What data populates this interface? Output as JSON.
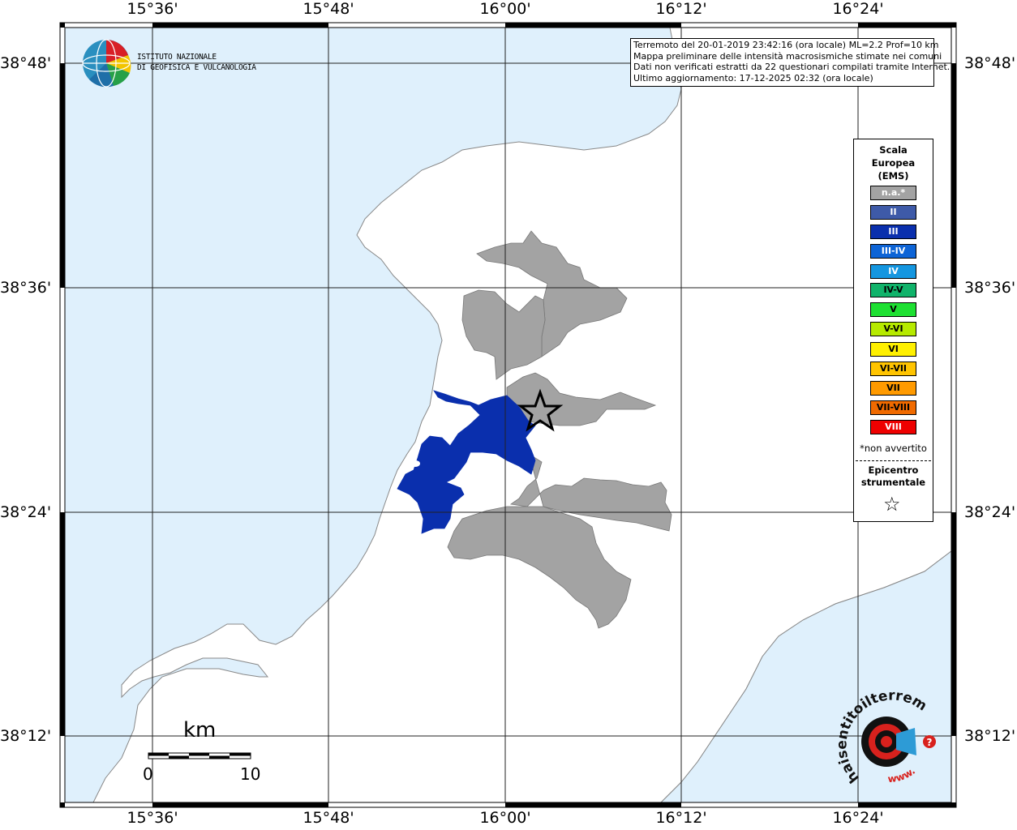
{
  "axes": {
    "top_labels": [
      "15°36'",
      "15°48'",
      "16°00'",
      "16°12'",
      "16°24'"
    ],
    "bottom_labels": [
      "15°36'",
      "15°48'",
      "16°00'",
      "16°12'",
      "16°24'"
    ],
    "left_labels": [
      "38°48'",
      "38°36'",
      "38°24'",
      "38°12'"
    ],
    "right_labels": [
      "38°48'",
      "38°36'",
      "38°24'",
      "38°12'"
    ]
  },
  "institute": {
    "line1": "ISTITUTO NAZIONALE",
    "line2": "DI GEOFISICA E VULCANOLOGIA"
  },
  "info": {
    "line1": "Terremoto del 20-01-2019 23:42:16 (ora locale) ML=2.2 Prof=10 km",
    "line2": "Mappa preliminare delle intensità macrosismiche stimate nei comuni",
    "line3": "Dati non verificati estratti da 22 questionari compilati tramite Internet.",
    "line4": "Ultimo aggiornamento: 17-12-2025 02:32 (ora locale)"
  },
  "legend": {
    "title_line1": "Scala",
    "title_line2": "Europea",
    "title_line3": "(EMS)",
    "items": [
      {
        "label": "n.a.*",
        "color": "#a3a3a3"
      },
      {
        "label": "II",
        "color": "#3e5aa8"
      },
      {
        "label": "III",
        "color": "#0a2fad"
      },
      {
        "label": "III-IV",
        "color": "#0d64d6"
      },
      {
        "label": "IV",
        "color": "#1496e0"
      },
      {
        "label": "IV-V",
        "color": "#10b36a"
      },
      {
        "label": "V",
        "color": "#1ee032"
      },
      {
        "label": "V-VI",
        "color": "#b6ea00"
      },
      {
        "label": "VI",
        "color": "#fff000"
      },
      {
        "label": "VI-VII",
        "color": "#ffc400"
      },
      {
        "label": "VII",
        "color": "#ff9a00"
      },
      {
        "label": "VII-VIII",
        "color": "#f06a00"
      },
      {
        "label": "VIII",
        "color": "#ee0000"
      }
    ],
    "note": "*non avvertito",
    "epicenter_line1": "Epicentro",
    "epicenter_line2": "strumentale",
    "star": "☆"
  },
  "scale_bar": {
    "unit": "km",
    "label_min": "0",
    "label_max": "10"
  },
  "colors": {
    "sea": "#dff0fc",
    "land": "#ffffff",
    "na_gray": "#a3a3a3",
    "intensity_III": "#0a2fad"
  },
  "logo": {
    "ring_text": "haisentitoilterremoto.it",
    "www_text": "www."
  }
}
